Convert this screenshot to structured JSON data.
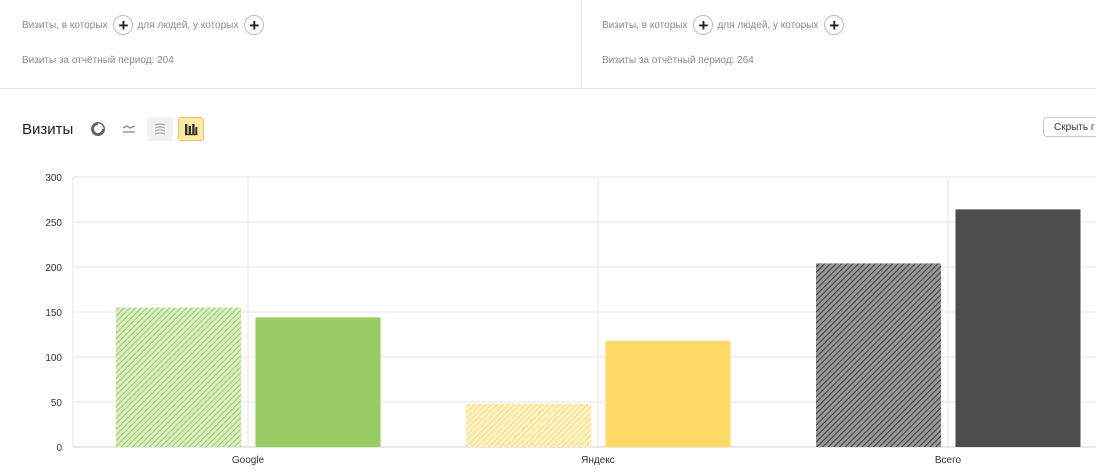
{
  "segments": [
    {
      "visits_where": "Визиты, в которых",
      "people_where": "для людей, у которых",
      "period_label": "Визиты за отчётный период: 204"
    },
    {
      "visits_where": "Визиты, в которых",
      "people_where": "для людей, у которых",
      "period_label": "Визиты за отчётный период: 264"
    }
  ],
  "toolbar": {
    "title": "Визиты",
    "hide_button": "Скрыть г",
    "icons": [
      "pie-chart-icon",
      "line-chart-icon",
      "area-chart-icon",
      "bar-chart-icon"
    ],
    "active_view": "bar"
  },
  "colors": {
    "google_seg1": "#c9e6a5",
    "google_seg2": "#98cc62",
    "yandex_seg1": "#fde7a0",
    "yandex_seg2": "#ffd966",
    "total_seg1": "#707070",
    "total_seg2": "#4d4d4d",
    "hatch_stroke_green": "#98cc62",
    "hatch_stroke_yellow": "#f9d876",
    "hatch_stroke_gray": "#3f3f3f"
  },
  "chart_data": {
    "type": "bar",
    "categories": [
      "Google",
      "Яндекс",
      "Всего"
    ],
    "series": [
      {
        "values": [
          155,
          48,
          204
        ],
        "style": "hatched"
      },
      {
        "values": [
          144,
          118,
          264
        ],
        "style": "solid"
      }
    ],
    "ylim": [
      0,
      300
    ],
    "yticks": [
      "300",
      "250",
      "200",
      "150",
      "100",
      "50",
      "0"
    ],
    "grid": true
  }
}
